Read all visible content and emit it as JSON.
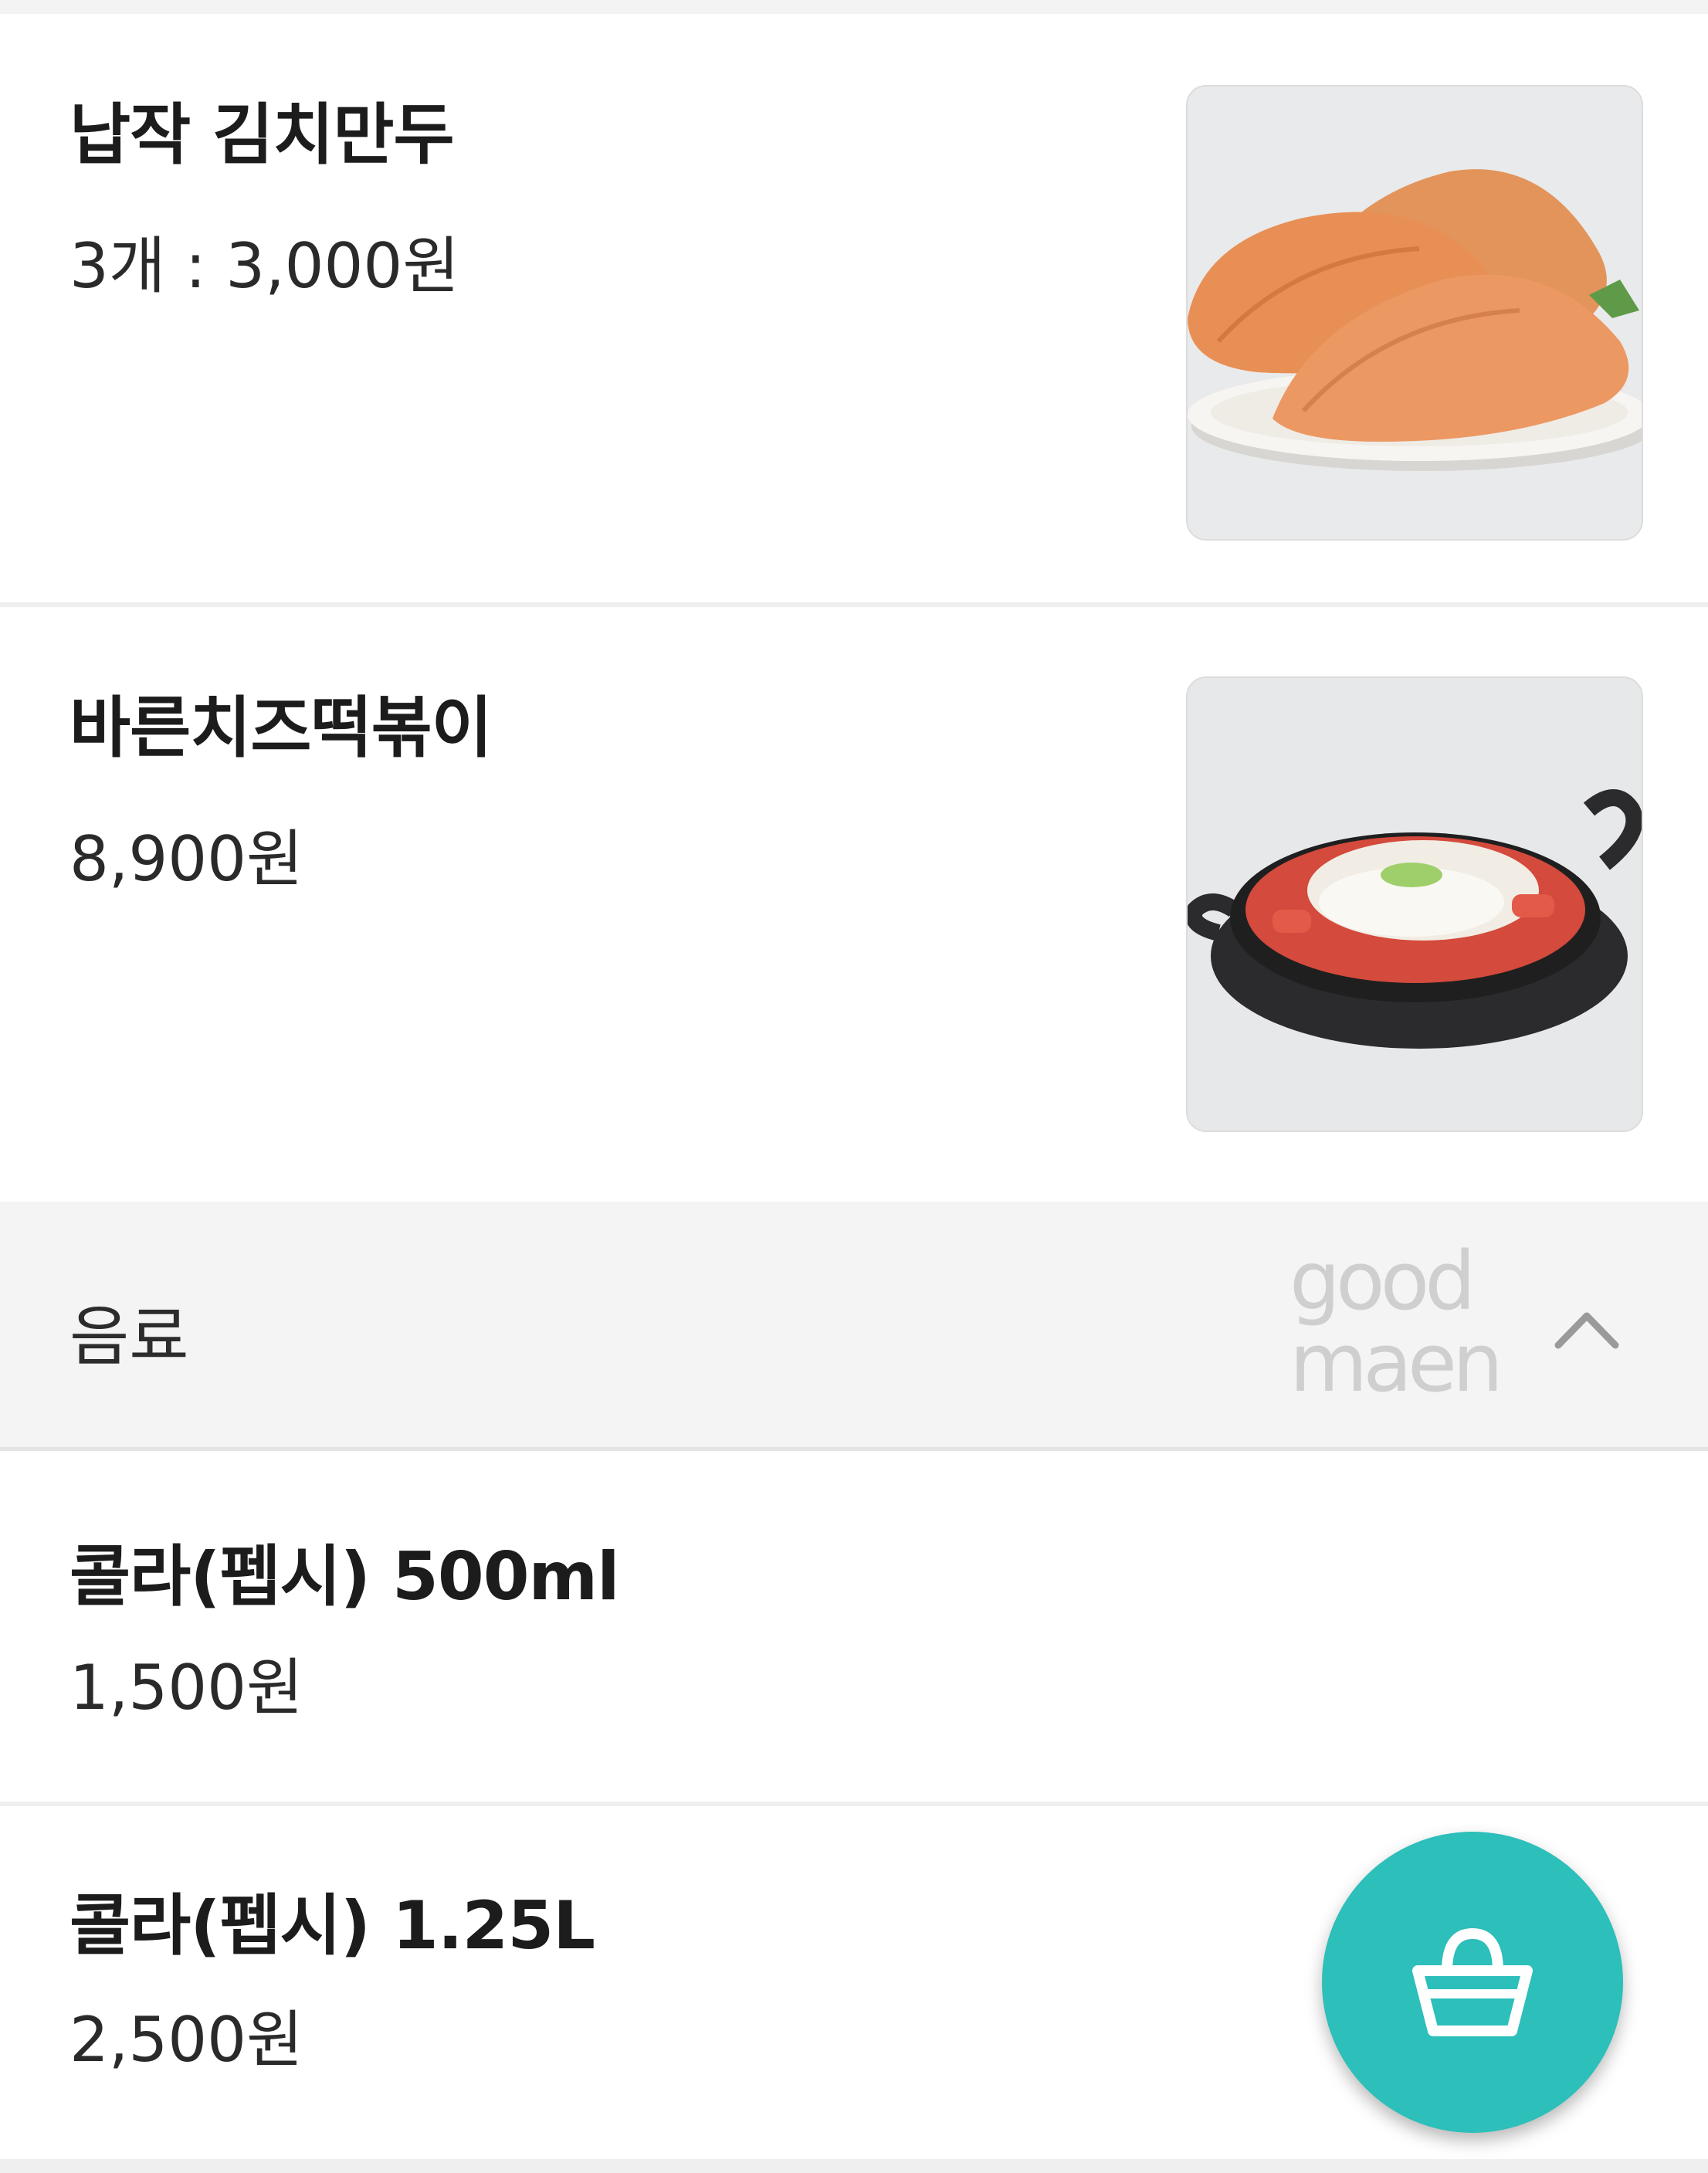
{
  "menu": {
    "items": [
      {
        "name": "납작 김치만두",
        "price": "3개 : 3,000원",
        "image": "flat-kimchi-dumplings-photo"
      },
      {
        "name": "바른치즈떡볶이",
        "price": "8,900원",
        "image": "cheese-tteokbokki-photo"
      }
    ]
  },
  "category": {
    "title": "음료",
    "watermark": [
      "good",
      "maen"
    ],
    "collapse_icon": "chevron-up-icon"
  },
  "drinks": {
    "items": [
      {
        "name": "콜라(펩시) 500ml",
        "price": "1,500원"
      },
      {
        "name": "콜라(펩시) 1.25L",
        "price": "2,500원"
      }
    ]
  },
  "cart": {
    "icon": "shopping-basket-icon",
    "color": "#2dbfba"
  }
}
